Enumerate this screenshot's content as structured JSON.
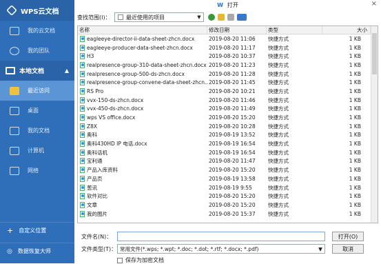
{
  "sidebar": {
    "title": "WPS云文档",
    "cloud_items": [
      {
        "label": "我的云文档",
        "icon": "cloud-doc-icon"
      },
      {
        "label": "我的团队",
        "icon": "team-icon"
      }
    ],
    "local_section": "本地文档",
    "local_items": [
      {
        "label": "最近访问",
        "icon": "folder-recent-icon",
        "active": true
      },
      {
        "label": "桌面",
        "icon": "desktop-icon"
      },
      {
        "label": "我的文档",
        "icon": "folder-icon"
      },
      {
        "label": "计算机",
        "icon": "computer-icon"
      },
      {
        "label": "网络",
        "icon": "network-icon"
      }
    ],
    "custom_location": "自定义位置",
    "data_recovery": "数据恢复大师"
  },
  "dialog": {
    "title_icon": "W",
    "title": "打开",
    "lookin_label": "查找范围(I)：",
    "lookin_value": "最近使用的项目",
    "columns": {
      "name": "名称",
      "date": "修改日期",
      "type": "类型",
      "size": "大小"
    },
    "files": [
      {
        "name": "eagleeye-director-ii-data-sheet-zhcn.docx",
        "date": "2019-08-20 11:06",
        "type": "快捷方式",
        "size": "1 KB"
      },
      {
        "name": "eagleeye-producer-data-sheet-zhcn.docx",
        "date": "2019-08-20 11:17",
        "type": "快捷方式",
        "size": "1 KB"
      },
      {
        "name": "H3",
        "date": "2019-08-20 10:37",
        "type": "快捷方式",
        "size": "1 KB"
      },
      {
        "name": "realpresence-group-310-data-sheet-zhcn.docx",
        "date": "2019-08-20 11:23",
        "type": "快捷方式",
        "size": "1 KB"
      },
      {
        "name": "realpresence-group-500-ds-zhcn.docx",
        "date": "2019-08-20 11:28",
        "type": "快捷方式",
        "size": "1 KB"
      },
      {
        "name": "realpresence-group-convene-data-sheet-zhcn...",
        "date": "2019-08-20 11:45",
        "type": "快捷方式",
        "size": "1 KB"
      },
      {
        "name": "RS Pro",
        "date": "2019-08-20 10:21",
        "type": "快捷方式",
        "size": "1 KB"
      },
      {
        "name": "vvx-150-ds-zhcn.docx",
        "date": "2019-08-20 11:46",
        "type": "快捷方式",
        "size": "1 KB"
      },
      {
        "name": "vvx-450-ds-zhcn.docx",
        "date": "2019-08-20 11:49",
        "type": "快捷方式",
        "size": "1 KB"
      },
      {
        "name": "wps VS office.docx",
        "date": "2019-08-20 15:20",
        "type": "快捷方式",
        "size": "1 KB"
      },
      {
        "name": "Z8X",
        "date": "2019-08-20 10:28",
        "type": "快捷方式",
        "size": "1 KB"
      },
      {
        "name": "奥科",
        "date": "2019-08-19 13:52",
        "type": "快捷方式",
        "size": "1 KB"
      },
      {
        "name": "奥科430HD IP 电话.docx",
        "date": "2019-08-19 16:54",
        "type": "快捷方式",
        "size": "1 KB"
      },
      {
        "name": "奥科话机",
        "date": "2019-08-19 16:54",
        "type": "快捷方式",
        "size": "1 KB"
      },
      {
        "name": "宝利通",
        "date": "2019-08-20 11:47",
        "type": "快捷方式",
        "size": "1 KB"
      },
      {
        "name": "产品入库资料",
        "date": "2019-08-20 15:20",
        "type": "快捷方式",
        "size": "1 KB"
      },
      {
        "name": "产品页",
        "date": "2019-08-19 13:58",
        "type": "快捷方式",
        "size": "1 KB"
      },
      {
        "name": "葱讯",
        "date": "2019-08-19 9:55",
        "type": "快捷方式",
        "size": "1 KB"
      },
      {
        "name": "软件对比",
        "date": "2019-08-20 15:20",
        "type": "快捷方式",
        "size": "1 KB"
      },
      {
        "name": "文章",
        "date": "2019-08-20 15:20",
        "type": "快捷方式",
        "size": "1 KB"
      },
      {
        "name": "我的图片",
        "date": "2019-08-20 15:37",
        "type": "快捷方式",
        "size": "1 KB"
      }
    ],
    "filename_label": "文件名(N)：",
    "filename_value": "",
    "open_button": "打开(O)",
    "filetype_label": "文件类型(T)：",
    "filetype_value": "常用文件(*.wps; *.wpt; *.doc; *.dot; *.rtf; *.docx; *.pdf)",
    "cancel_button": "取消",
    "encrypt_label": "保存为加密文档"
  }
}
